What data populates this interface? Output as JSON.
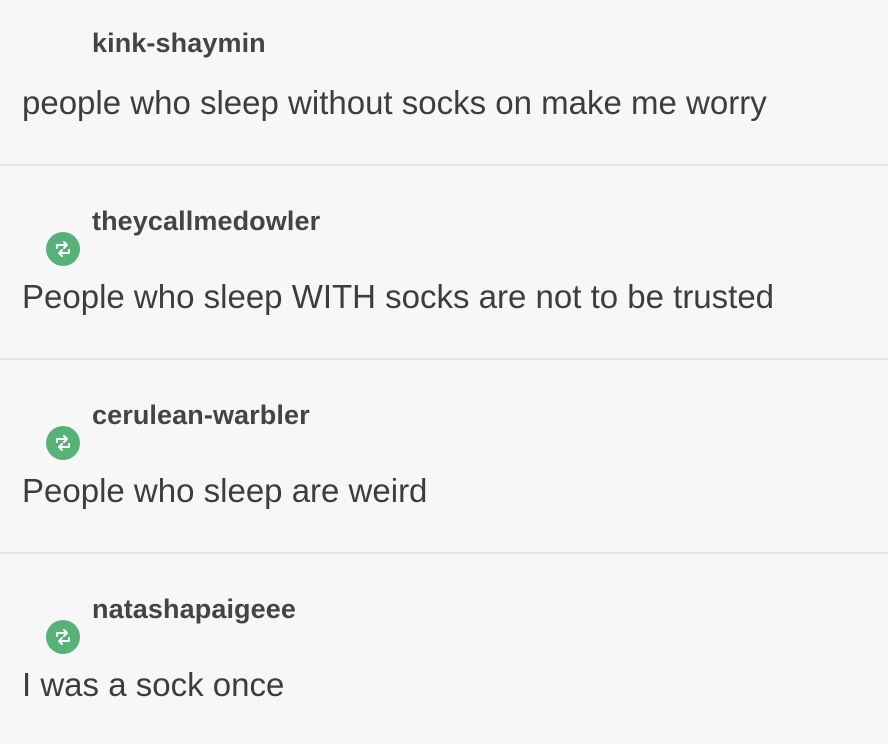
{
  "thread": {
    "posts": [
      {
        "username": "kink-shaymin",
        "text": "people who sleep without socks on make me worry",
        "reblog": false
      },
      {
        "username": "theycallmedowler",
        "text": "People who sleep WITH socks are not to be trusted",
        "reblog": true
      },
      {
        "username": "cerulean-warbler",
        "text": "People who sleep are weird",
        "reblog": true
      },
      {
        "username": "natashapaigeee",
        "text": "I was a sock once",
        "reblog": true
      }
    ]
  },
  "colors": {
    "background": "#f7f7f7",
    "divider": "#e4e4e4",
    "username": "#444444",
    "text": "#3d3d3d",
    "reblog_icon": "#56b279"
  },
  "icons": {
    "reblog": "reblog-icon"
  }
}
